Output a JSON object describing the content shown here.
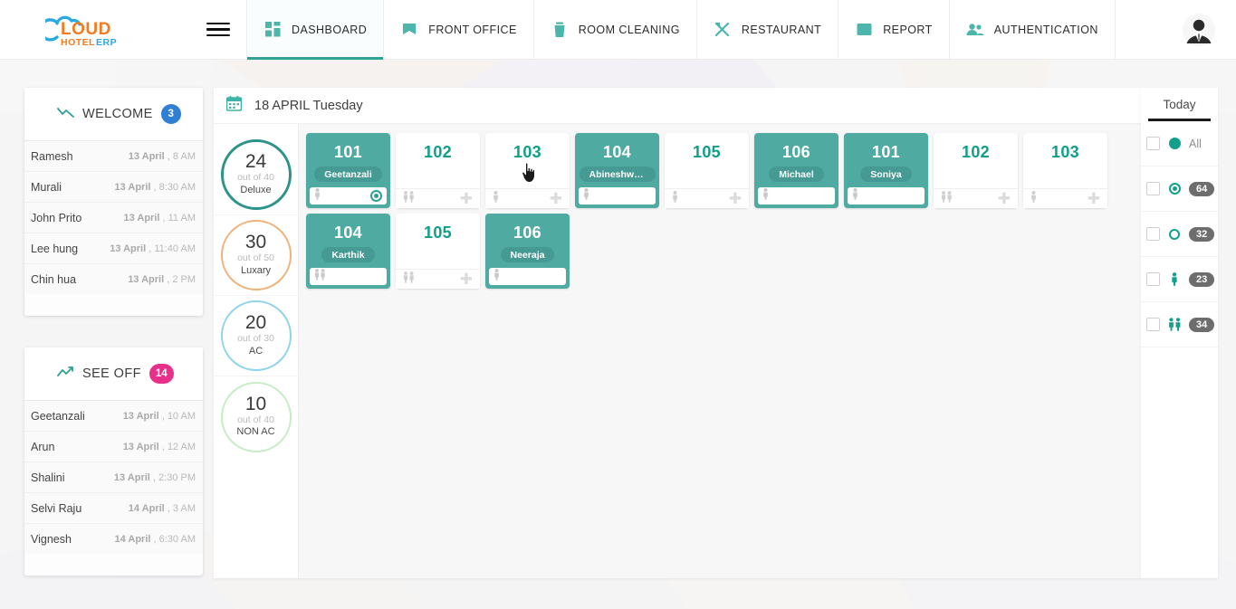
{
  "brand": {
    "name_cloud": "CLOUD",
    "name_sub_hotel": "HOTEL",
    "name_sub_erp": "ERP"
  },
  "navbar": {
    "menu_icon": "hamburger-icon",
    "avatar_icon": "user-avatar-icon",
    "items": [
      {
        "label": "DASHBOARD",
        "icon": "grid-icon",
        "active": true
      },
      {
        "label": "FRONT OFFICE",
        "icon": "book-icon",
        "active": false
      },
      {
        "label": "ROOM CLEANING",
        "icon": "trash-icon",
        "active": false
      },
      {
        "label": "RESTAURANT",
        "icon": "cutlery-icon",
        "active": false
      },
      {
        "label": "REPORT",
        "icon": "square-icon",
        "active": false
      },
      {
        "label": "AUTHENTICATION",
        "icon": "users-icon",
        "active": false
      }
    ]
  },
  "welcome_panel": {
    "title": "WELCOME",
    "icon": "trend-down-icon",
    "count": "3",
    "badge_color": "#2f7fd4",
    "rows": [
      {
        "name": "Ramesh",
        "date": "13 April",
        "time": "8 AM"
      },
      {
        "name": "Murali",
        "date": "13 April",
        "time": "8:30 AM"
      },
      {
        "name": "John Prito",
        "date": "13 April",
        "time": "11 AM"
      },
      {
        "name": "Lee hung",
        "date": "13 April",
        "time": "11:40 AM"
      },
      {
        "name": "Chin hua",
        "date": "13 April",
        "time": "2 PM"
      }
    ]
  },
  "seeoff_panel": {
    "title": "SEE OFF",
    "icon": "trend-up-icon",
    "count": "14",
    "badge_color": "#e8308a",
    "rows": [
      {
        "name": "Geetanzali",
        "date": "13 April",
        "time": "10 AM"
      },
      {
        "name": "Arun",
        "date": "13 April",
        "time": "12 AM"
      },
      {
        "name": "Shalini",
        "date": "13 April",
        "time": "2:30 PM"
      },
      {
        "name": "Selvi Raju",
        "date": "14 April",
        "time": "3 AM"
      },
      {
        "name": "Vignesh",
        "date": "14 April",
        "time": "6:30 AM"
      }
    ]
  },
  "board": {
    "calendar_icon": "calendar-icon",
    "date_label": "18 APRIL Tuesday",
    "capacity": [
      {
        "value": "24",
        "of": "out of 40",
        "label": "Deluxe",
        "color": "#2d9389"
      },
      {
        "value": "30",
        "of": "out of 50",
        "label": "Luxary",
        "color": "#f0b27a"
      },
      {
        "value": "20",
        "of": "out of 30",
        "label": "AC",
        "color": "#8fd4ea"
      },
      {
        "value": "10",
        "of": "out of 40",
        "label": "NON AC",
        "color": "#c6ecc6"
      }
    ],
    "rooms_row1": [
      {
        "number": "101",
        "guest": "Geetanzali",
        "occupied": true,
        "occupancy_icon": "single-person-icon",
        "status_icon": "occupied-dot-icon"
      },
      {
        "number": "102",
        "guest": "",
        "occupied": false,
        "occupancy_icon": "two-person-icon",
        "status_icon": "plus-icon"
      },
      {
        "number": "103",
        "guest": "",
        "occupied": false,
        "occupancy_icon": "single-person-icon",
        "status_icon": "plus-icon"
      },
      {
        "number": "104",
        "guest": "Abineshwari",
        "occupied": true,
        "occupancy_icon": "single-person-icon",
        "status_icon": ""
      },
      {
        "number": "105",
        "guest": "",
        "occupied": false,
        "occupancy_icon": "single-person-icon",
        "status_icon": "plus-icon"
      },
      {
        "number": "106",
        "guest": "Michael",
        "occupied": true,
        "occupancy_icon": "single-person-icon",
        "status_icon": ""
      },
      {
        "number": "101",
        "guest": "Soniya",
        "occupied": true,
        "occupancy_icon": "single-person-icon",
        "status_icon": ""
      },
      {
        "number": "102",
        "guest": "",
        "occupied": false,
        "occupancy_icon": "two-person-icon",
        "status_icon": "plus-icon"
      },
      {
        "number": "103",
        "guest": "",
        "occupied": false,
        "occupancy_icon": "single-person-icon",
        "status_icon": "plus-icon"
      }
    ],
    "rooms_row2": [
      {
        "number": "104",
        "guest": "Karthik",
        "occupied": true,
        "occupancy_icon": "two-person-icon",
        "status_icon": ""
      },
      {
        "number": "105",
        "guest": "",
        "occupied": false,
        "occupancy_icon": "two-person-icon",
        "status_icon": "plus-icon"
      },
      {
        "number": "106",
        "guest": "Neeraja",
        "occupied": true,
        "occupancy_icon": "single-person-icon",
        "status_icon": ""
      }
    ]
  },
  "rail": {
    "tab_label": "Today",
    "filters": [
      {
        "icon": "solid-dot-icon",
        "label": "All",
        "count": ""
      },
      {
        "icon": "ring-dot-icon",
        "label": "",
        "count": "64"
      },
      {
        "icon": "hollow-dot-icon",
        "label": "",
        "count": "32"
      },
      {
        "icon": "single-person-icon",
        "label": "",
        "count": "23"
      },
      {
        "icon": "two-person-icon",
        "label": "",
        "count": "34"
      }
    ]
  },
  "colors": {
    "teal": "#4faaa2",
    "teal_dark": "#2fa094",
    "accent_green": "#10a08c",
    "badge_gray": "#6d6d6d",
    "logo_orange": "#f47c20",
    "logo_blue": "#29a9e0"
  }
}
